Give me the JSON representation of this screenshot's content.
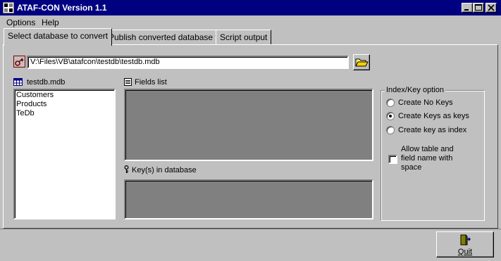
{
  "window": {
    "title": "ATAF-CON Version 1.1"
  },
  "menu": {
    "items": [
      "Options",
      "Help"
    ]
  },
  "tabs": [
    {
      "label": "Select database to convert",
      "active": true
    },
    {
      "label": "Publish converted database to",
      "active": false
    },
    {
      "label": "Script output",
      "active": false
    }
  ],
  "path": {
    "value": "V:\\Files\\VB\\atafcon\\testdb\\testdb.mdb"
  },
  "database": {
    "name": "testdb.mdb",
    "tables": [
      "Customers",
      "Products",
      "TeDb"
    ]
  },
  "fields": {
    "label": "Fields list"
  },
  "keys": {
    "label": "Key(s) in database"
  },
  "index_option": {
    "title": "Index/Key option",
    "options": [
      {
        "label": "Create No Keys",
        "selected": false
      },
      {
        "label": "Create Keys as keys",
        "selected": true
      },
      {
        "label": "Create key as index",
        "selected": false
      }
    ],
    "allow_space": {
      "label_lines": [
        "Allow table and",
        "field name with",
        "space"
      ],
      "checked": false
    }
  },
  "quit": {
    "label": "Quit"
  },
  "colors": {
    "titlebar": "#000080",
    "face": "#c0c0c0",
    "shadow": "#808080"
  }
}
